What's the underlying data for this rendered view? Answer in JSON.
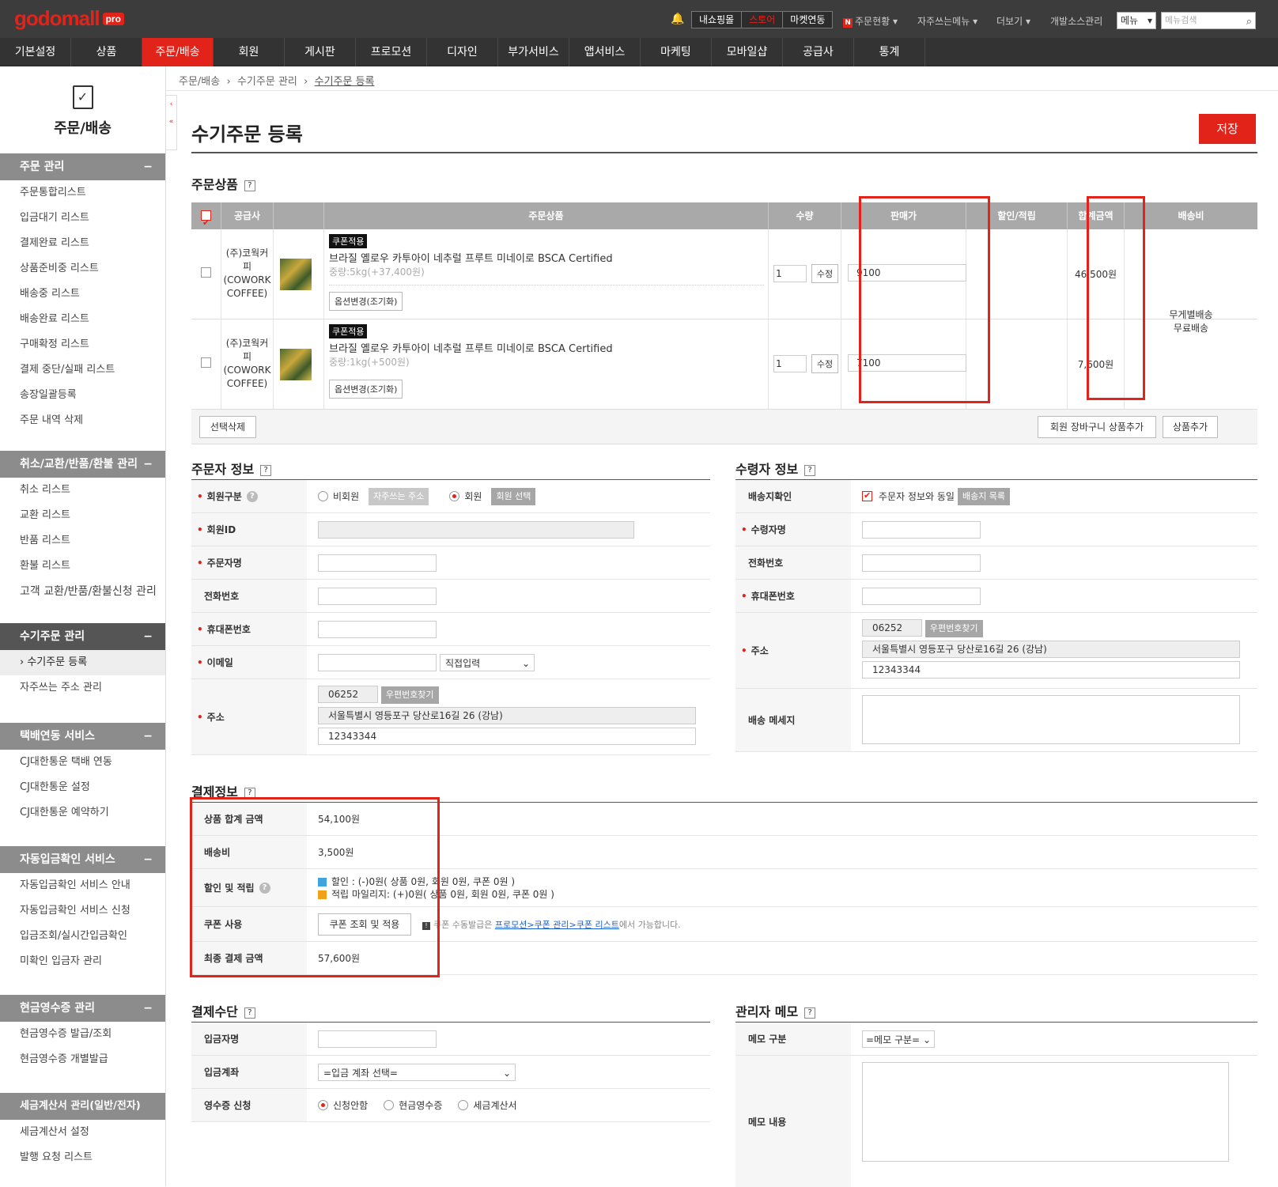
{
  "brand": {
    "logo": "godomall",
    "pro": "pro"
  },
  "topbar": {
    "shop_tabs": [
      "내쇼핑몰",
      "스토어",
      "마켓연동"
    ],
    "links": [
      "주문현황",
      "자주쓰는메뉴",
      "더보기",
      "개발소스관리"
    ],
    "menu_select": "메뉴",
    "search_placeholder": "메뉴검색"
  },
  "gnb": [
    "기본설정",
    "상품",
    "주문/배송",
    "회원",
    "게시판",
    "프로모션",
    "디자인",
    "부가서비스",
    "앱서비스",
    "마케팅",
    "모바일샵",
    "공급사",
    "통계"
  ],
  "sidebar": {
    "title": "주문/배송",
    "sections": [
      {
        "title": "주문 관리",
        "items": [
          "주문통합리스트",
          "입금대기 리스트",
          "결제완료 리스트",
          "상품준비중 리스트",
          "배송중 리스트",
          "배송완료 리스트",
          "구매확정 리스트",
          "결제 중단/실패 리스트",
          "송장일괄등록",
          "주문 내역 삭제"
        ]
      },
      {
        "title": "취소/교환/반품/환불 관리",
        "items": [
          "취소 리스트",
          "교환 리스트",
          "반품 리스트",
          "환불 리스트",
          "고객 교환/반품/환불신청 관리"
        ]
      },
      {
        "title": "수기주문 관리",
        "items": [
          "› 수기주문 등록",
          "자주쓰는 주소 관리"
        ]
      },
      {
        "title": "택배연동 서비스",
        "items": [
          "CJ대한통운 택배 연동",
          "CJ대한통운 설정",
          "CJ대한통운 예약하기"
        ]
      },
      {
        "title": "자동입금확인 서비스",
        "items": [
          "자동입금확인 서비스 안내",
          "자동입금확인 서비스 신청",
          "입금조회/실시간입금확인",
          "미확인 입금자 관리"
        ]
      },
      {
        "title": "현금영수증 관리",
        "items": [
          "현금영수증 발급/조회",
          "현금영수증 개별발급"
        ]
      },
      {
        "title": "세금계산서 관리(일반/전자)",
        "items": [
          "세금계산서 설정",
          "발행 요청 리스트"
        ]
      }
    ]
  },
  "breadcrumb": [
    "주문/배송",
    "수기주문 관리",
    "수기주문 등록"
  ],
  "page": {
    "title": "수기주문 등록",
    "save": "저장"
  },
  "order_products": {
    "title": "주문상품",
    "help": "?",
    "columns": [
      "공급사",
      "주문상품",
      "수량",
      "판매가",
      "할인/적립",
      "합계금액",
      "배송비"
    ],
    "rows": [
      {
        "supplier": "(주)코웍커피 (COWORK COFFEE)",
        "badge": "쿠폰적용",
        "name": "브라질 옐로우 카투아이 네추럴 프루트 미네이로 BSCA Certified",
        "option": "중량:5kg(+37,400원)",
        "option_btn": "옵션변경(조기화)",
        "qty": "1",
        "qty_btn": "수정",
        "price": "9100",
        "total": "46,500원"
      },
      {
        "supplier": "(주)코웍커피 (COWORK COFFEE)",
        "badge": "쿠폰적용",
        "name": "브라질 옐로우 카투아이 네추럴 프루트 미네이로 BSCA Certified",
        "option": "중량:1kg(+500원)",
        "option_btn": "옵션변경(조기화)",
        "qty": "1",
        "qty_btn": "수정",
        "price": "7100",
        "total": "7,600원"
      }
    ],
    "shipping": [
      "무게별배송",
      "무료배송"
    ],
    "delete_btn": "선택삭제",
    "cart_btn": "회원 장바구니 상품추가",
    "add_btn": "상품추가"
  },
  "orderer": {
    "title": "주문자 정보",
    "labels": [
      "회원구분",
      "회원ID",
      "주문자명",
      "전화번호",
      "휴대폰번호",
      "이메일",
      "주소"
    ],
    "nonmember": "비회원",
    "fav_addr": "자주쓰는 주소",
    "member": "회원",
    "member_select": "회원 선택",
    "email_select": "직접입력",
    "zip": "06252",
    "zip_btn": "우편번호찾기",
    "addr1": "서울특별시 영등포구 당산로16길 26 (강남)",
    "addr2": "12343344"
  },
  "receiver": {
    "title": "수령자 정보",
    "labels": [
      "배송지확인",
      "수령자명",
      "전화번호",
      "휴대폰번호",
      "주소",
      "배송 메세지"
    ],
    "same": "주문자 정보와 동일",
    "list_btn": "배송지 목록",
    "zip": "06252",
    "zip_btn": "우편번호찾기",
    "addr1": "서울특별시 영등포구 당산로16길 26 (강남)",
    "addr2": "12343344"
  },
  "payment": {
    "title": "결제정보",
    "labels": [
      "상품 합계 금액",
      "배송비",
      "할인 및 적립",
      "쿠폰 사용",
      "최종 결제 금액"
    ],
    "goods_total": "54,100원",
    "delivery": "3,500원",
    "discount": "할인 : (-)0원( 상품 0원, 회원 0원, 쿠폰 0원 )",
    "mileage": "적립 마일리지: (+)0원( 상품 0원, 회원 0원, 쿠폰 0원 )",
    "coupon_btn": "쿠폰 조회 및 적용",
    "coupon_note_pre": "쿠폰 수동발급은 ",
    "coupon_note_link": "프로모션>쿠폰 관리>쿠폰 리스트",
    "coupon_note_post": "에서 가능합니다.",
    "final": "57,600원"
  },
  "method": {
    "title": "결제수단",
    "labels": [
      "입금자명",
      "입금계좌",
      "영수증 신청"
    ],
    "account_select": "=입금 계좌 선택=",
    "receipt_opts": [
      "신청안함",
      "현금영수증",
      "세금계산서"
    ]
  },
  "memo": {
    "title": "관리자 메모",
    "labels": [
      "메모 구분",
      "메모 내용"
    ],
    "select": "=메모 구분="
  }
}
